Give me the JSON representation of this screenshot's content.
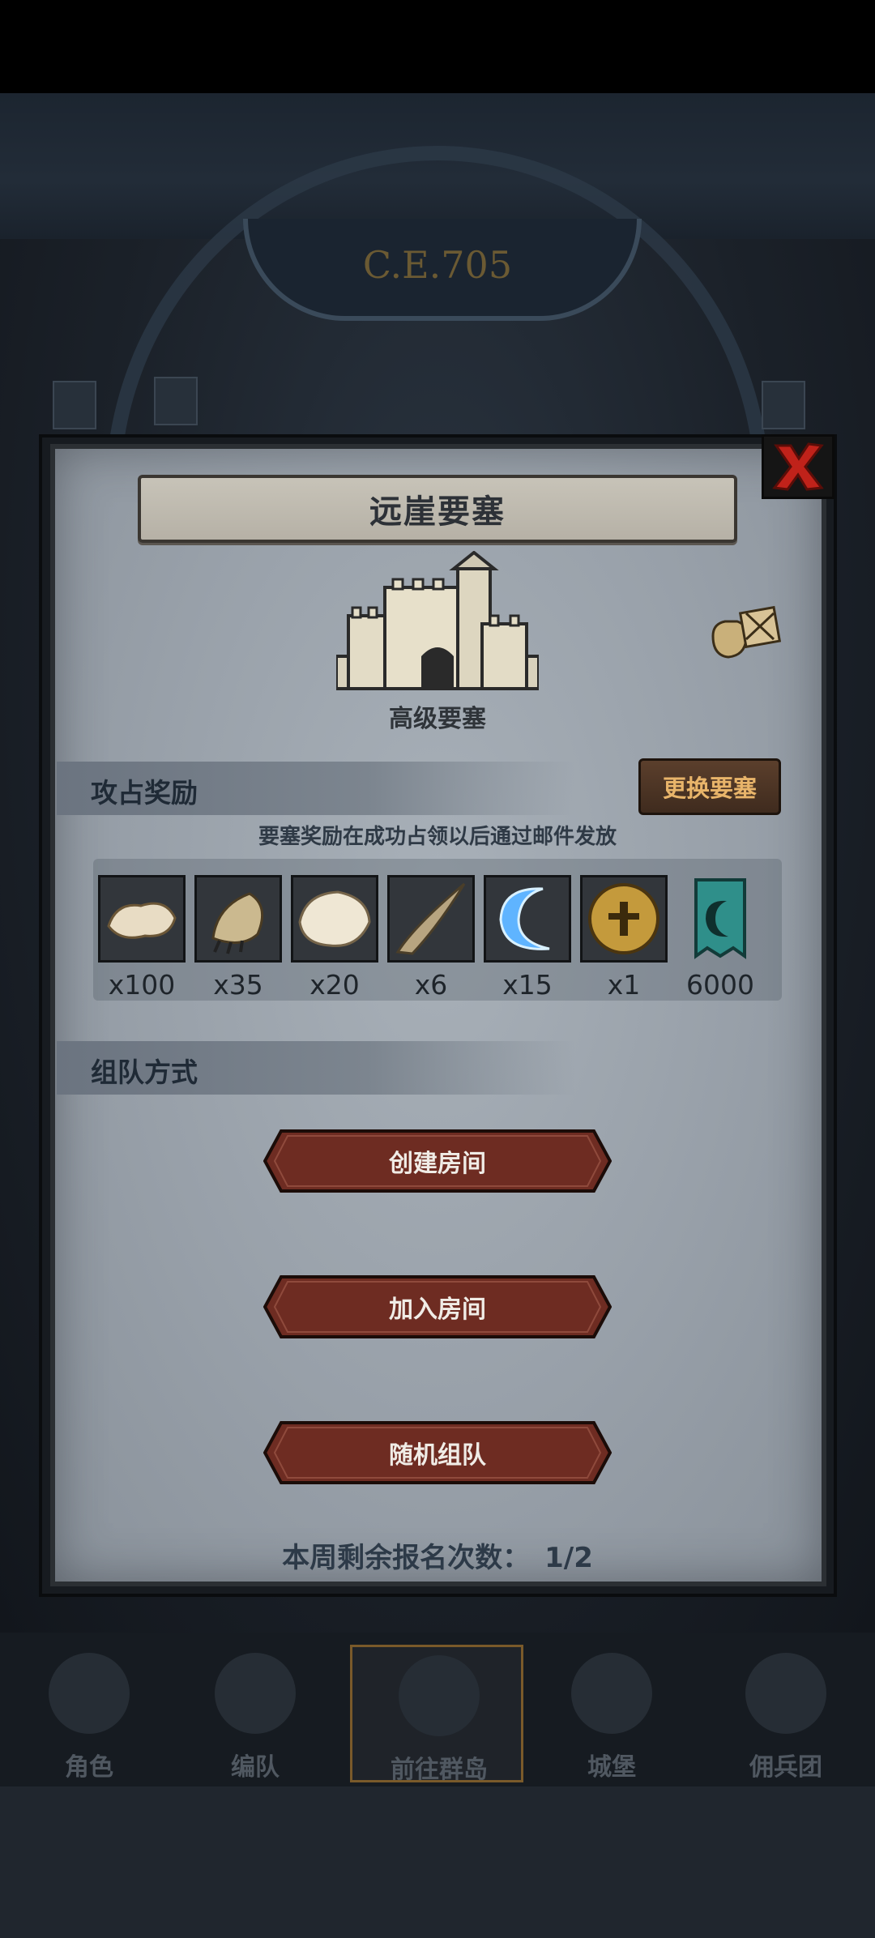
{
  "background": {
    "era": "C.E.705",
    "nav": [
      {
        "label": "角色",
        "icon": "knight-icon"
      },
      {
        "label": "编队",
        "icon": "helmet-group-icon"
      },
      {
        "label": "前往群岛",
        "icon": "globe-compass-icon"
      },
      {
        "label": "城堡",
        "icon": "castle-icon"
      },
      {
        "label": "佣兵团",
        "icon": "mercenary-icon"
      }
    ]
  },
  "dialog": {
    "title": "远崖要塞",
    "fortress_level": "高级要塞",
    "conquest_section": "攻占奖励",
    "swap_button": "更换要塞",
    "reward_note": "要塞奖励在成功占领以后通过邮件发放",
    "rewards": [
      {
        "icon": "fur-pelt-icon",
        "count": "x100"
      },
      {
        "icon": "beast-claw-icon",
        "count": "x35"
      },
      {
        "icon": "white-pelt-icon",
        "count": "x20"
      },
      {
        "icon": "horn-icon",
        "count": "x6"
      },
      {
        "icon": "blue-crescent-icon",
        "count": "x15"
      },
      {
        "icon": "golden-helmet-icon",
        "count": "x1"
      },
      {
        "icon": "banner-emblem-icon",
        "count": "6000"
      }
    ],
    "team_section": "组队方式",
    "buttons": {
      "create_room": "创建房间",
      "join_room": "加入房间",
      "random_team": "随机组队"
    },
    "remaining_label": "本周剩余报名次数：",
    "remaining_value": "1/2"
  },
  "colors": {
    "panel": "#9aa2ab",
    "button_red": "#6e2c22",
    "accent_gold": "#e8b46a",
    "close_red": "#c0221a"
  }
}
